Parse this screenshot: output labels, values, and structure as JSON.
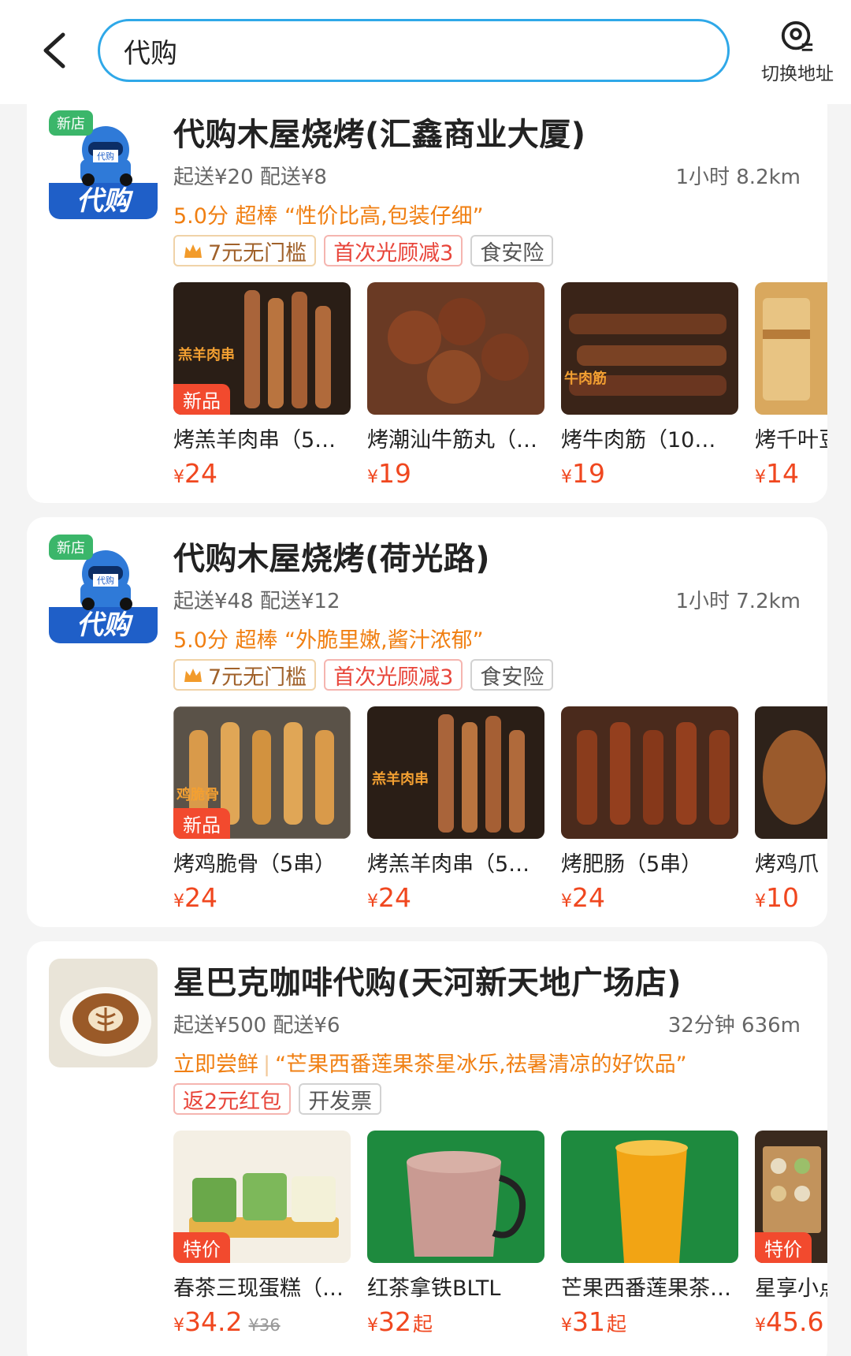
{
  "search": {
    "value": "代购"
  },
  "header": {
    "switch_address": "切换地址"
  },
  "stores": [
    {
      "logo_label": "代购",
      "logo_badge": "新店",
      "logo_small": "代购",
      "name": "代购木屋烧烤(汇鑫商业大厦)",
      "delivery": "起送¥20 配送¥8",
      "time_dist": "1小时 8.2km",
      "rating": "5.0分 超棒 “性价比高,包装仔细”",
      "tags": [
        "7元无门槛",
        "首次光顾减3",
        "食安险"
      ],
      "items": [
        {
          "name": "烤羔羊肉串（5…",
          "currency": "¥",
          "price": "24",
          "badge": "新品",
          "img_text": "羔羊肉串"
        },
        {
          "name": "烤潮汕牛筋丸（…",
          "currency": "¥",
          "price": "19",
          "badge": "",
          "img_text": ""
        },
        {
          "name": "烤牛肉筋（10…",
          "currency": "¥",
          "price": "19",
          "badge": "",
          "img_text": "牛肉筋"
        },
        {
          "name": "烤千叶豆",
          "currency": "¥",
          "price": "14",
          "badge": "",
          "img_text": ""
        }
      ]
    },
    {
      "logo_label": "代购",
      "logo_badge": "新店",
      "logo_small": "代购",
      "name": "代购木屋烧烤(荷光路)",
      "delivery": "起送¥48 配送¥12",
      "time_dist": "1小时 7.2km",
      "rating": "5.0分 超棒 “外脆里嫩,酱汁浓郁”",
      "tags": [
        "7元无门槛",
        "首次光顾减3",
        "食安险"
      ],
      "items": [
        {
          "name": "烤鸡脆骨（5串）",
          "currency": "¥",
          "price": "24",
          "badge": "新品",
          "img_text": "鸡脆骨"
        },
        {
          "name": "烤羔羊肉串（5…",
          "currency": "¥",
          "price": "24",
          "badge": "",
          "img_text": "羔羊肉串"
        },
        {
          "name": "烤肥肠（5串）",
          "currency": "¥",
          "price": "24",
          "badge": "",
          "img_text": ""
        },
        {
          "name": "烤鸡爪",
          "currency": "¥",
          "price": "10",
          "badge": "",
          "img_text": ""
        }
      ]
    },
    {
      "name": "星巴克咖啡代购(天河新天地广场店)",
      "delivery": "起送¥500 配送¥6",
      "time_dist": "32分钟 636m",
      "rating_prefix": "立即尝鲜",
      "rating_quote": "“芒果西番莲果茶星冰乐,祛暑清凉的好饮品”",
      "tags": [
        "返2元红包",
        "开发票"
      ],
      "items": [
        {
          "name": "春茶三现蛋糕（…",
          "currency": "¥",
          "price": "34.2",
          "suffix": "",
          "orig": "¥36",
          "badge": "特价"
        },
        {
          "name": "红茶拿铁BLTL",
          "currency": "¥",
          "price": "32",
          "suffix": "起",
          "orig": "",
          "badge": ""
        },
        {
          "name": "芒果西番莲果茶…",
          "currency": "¥",
          "price": "31",
          "suffix": "起",
          "orig": "",
          "badge": ""
        },
        {
          "name": "星享小点",
          "currency": "¥",
          "price": "45.6",
          "suffix": "",
          "orig": "",
          "badge": "特价"
        }
      ]
    }
  ],
  "colors": {
    "accent_blue": "#2fa8e8",
    "orange": "#f07f12",
    "price_red": "#f0471f",
    "badge_red": "#f24a2e"
  }
}
